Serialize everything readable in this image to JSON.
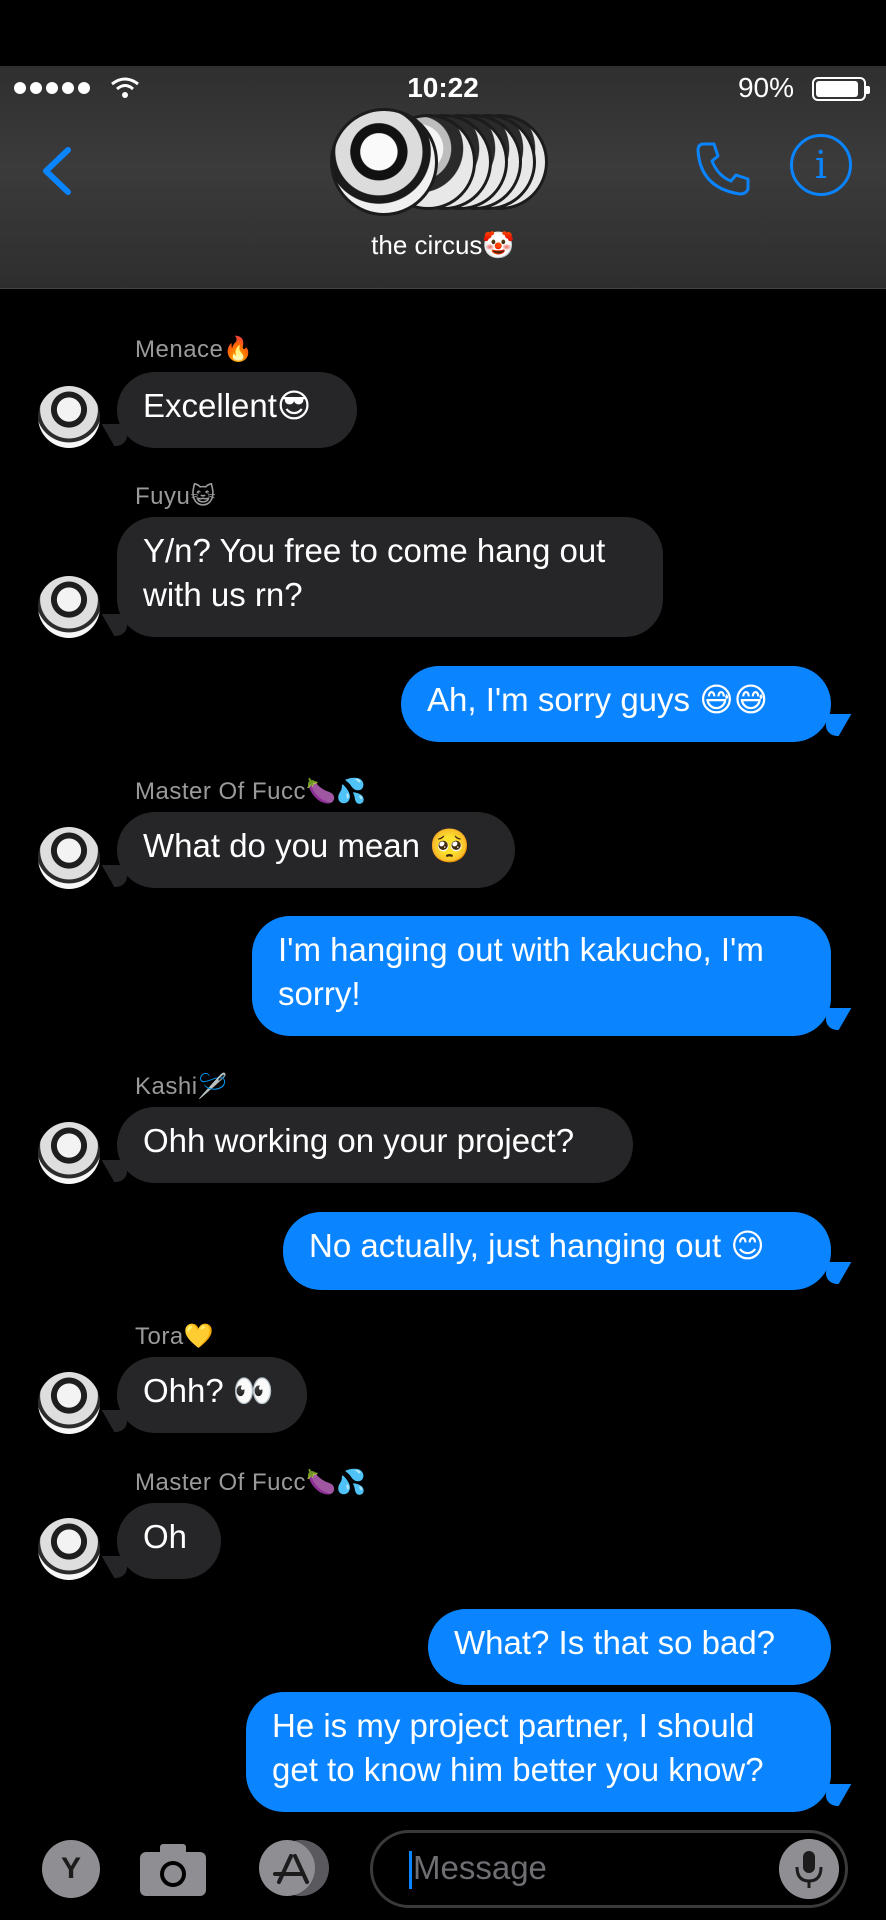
{
  "status_bar": {
    "time": "10:22",
    "battery_percent": "90%",
    "signal_bars": 5
  },
  "header": {
    "group_name": "the circus🤡"
  },
  "messages": [
    {
      "sender": "Menace🔥",
      "text": "Excellent😎"
    },
    {
      "sender": "Fuyu😺",
      "text": "Y/n? You free to come hang out with us rn?"
    },
    {
      "text": "Ah, I'm sorry guys 😅😅"
    },
    {
      "sender": "Master Of Fucc🍆💦",
      "text": "What do you mean 🥺"
    },
    {
      "text": "I'm hanging out with kakucho, I'm sorry!"
    },
    {
      "sender": "Kashi🪡",
      "text": "Ohh working on your project?"
    },
    {
      "text": "No actually, just hanging out 😊"
    },
    {
      "sender": "Tora💛",
      "text": "Ohh? 👀"
    },
    {
      "sender": "Master Of Fucc🍆💦",
      "text": "Oh"
    },
    {
      "text": "What? Is that so bad?"
    },
    {
      "text": "He is my project partner, I should get to know him better you know?"
    }
  ],
  "input_bar": {
    "avatar_letter": "Y",
    "placeholder": "Message"
  },
  "icons": [
    "back-chevron-icon",
    "phone-icon",
    "info-icon",
    "camera-icon",
    "app-store-icon",
    "microphone-icon",
    "wifi-icon",
    "battery-icon"
  ],
  "colors": {
    "accent": "#0a84ff",
    "incoming_bubble": "#262628",
    "background": "#000000"
  }
}
